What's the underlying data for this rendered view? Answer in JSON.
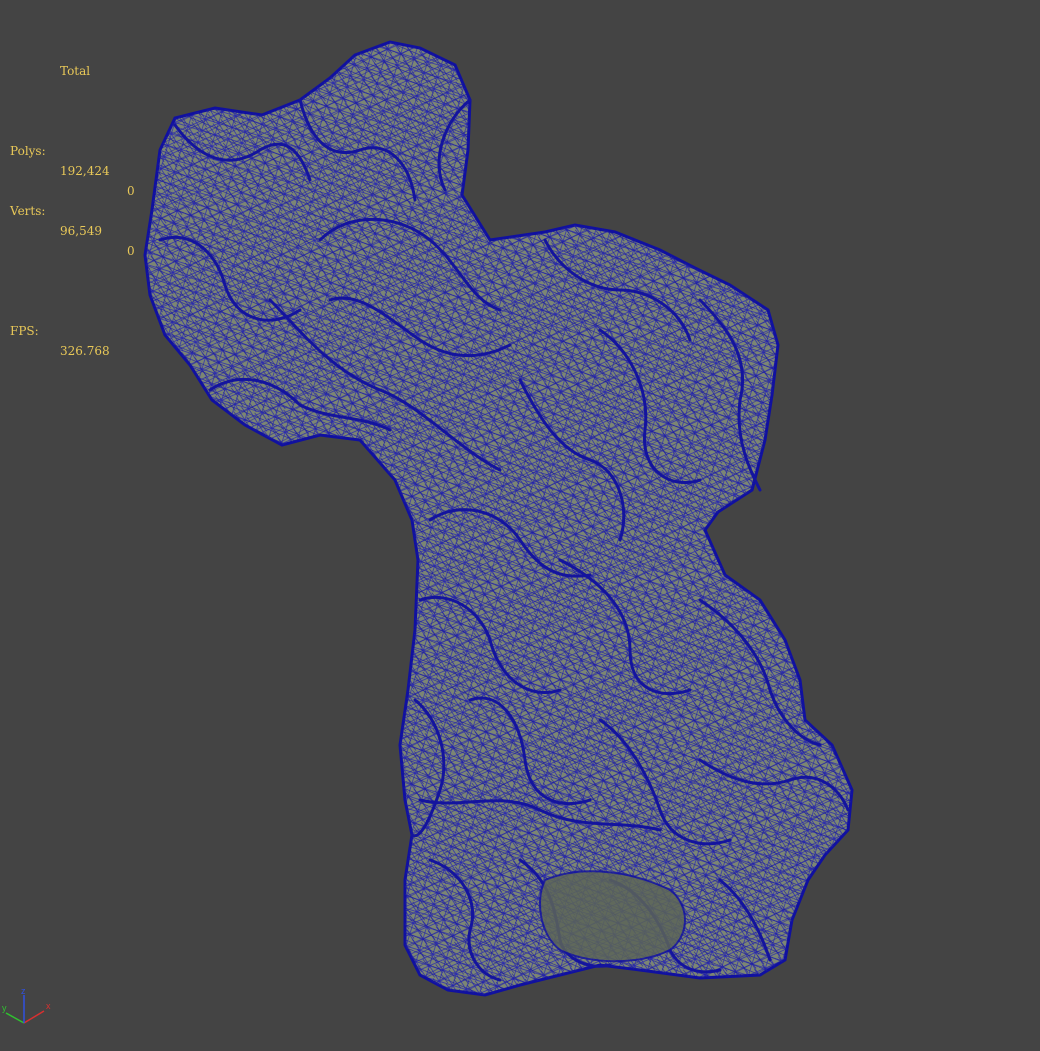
{
  "viewport": {
    "background_color": "#444444",
    "stats": {
      "header": "Total",
      "polys_label": "Polys:",
      "polys_value": "192,424",
      "polys_selected": "0",
      "verts_label": "Verts:",
      "verts_value": "96,549",
      "verts_selected": "0",
      "fps_label": "FPS:",
      "fps_value": "326.768",
      "text_color": "#e8c858"
    },
    "model": {
      "name": "rock-sculpture-mesh",
      "display_mode": "smooth-shaded-with-wireframe",
      "wire_color": "#1a1aa8",
      "fill_color": "#7c8673"
    },
    "axis_gizmo": {
      "x_color": "#d83030",
      "y_color": "#30c030",
      "z_color": "#3050e0",
      "x_label": "x",
      "y_label": "y",
      "z_label": "z"
    }
  }
}
